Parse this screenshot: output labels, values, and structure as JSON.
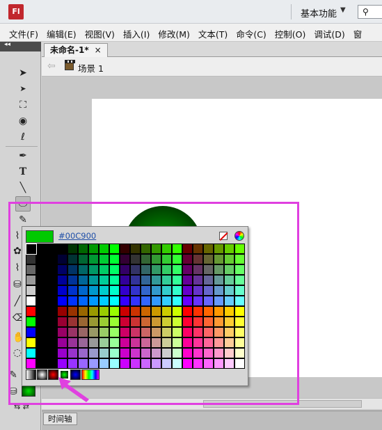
{
  "app": {
    "logo": "Fl",
    "workspace": "基本功能",
    "workspace_arrow": "▼",
    "search_placeholder": ""
  },
  "menu": [
    "文件(F)",
    "编辑(E)",
    "视图(V)",
    "插入(I)",
    "修改(M)",
    "文本(T)",
    "命令(C)",
    "控制(O)",
    "调试(D)",
    "窗"
  ],
  "tools": {
    "collapse": "◂◂",
    "icons": [
      "selection-tool-icon",
      "subselection-tool-icon",
      "free-transform-tool-icon",
      "3d-rotation-tool-icon",
      "lasso-tool-icon",
      "pen-tool-icon",
      "text-tool-icon",
      "line-tool-icon",
      "oval-tool-icon",
      "pencil-tool-icon",
      "brush-tool-icon",
      "deco-tool-icon",
      "bone-tool-icon",
      "paint-bucket-tool-icon",
      "eyedropper-tool-icon",
      "eraser-tool-icon",
      "hand-tool-icon",
      "zoom-tool-icon",
      "stroke-color-icon",
      "fill-color-icon",
      "swap-colors-icon"
    ]
  },
  "document": {
    "tab_label": "未命名-1*",
    "tab_close": "×",
    "scene_label": "场景 1",
    "back_arrow": "⇦",
    "timeline_label": "时间轴"
  },
  "color_picker": {
    "hex": "#00C900",
    "preview_color": "#00c900",
    "gradient_swatches": [
      "#999999-gradient",
      "white-black-radial",
      "red-radial",
      "green-radial",
      "blue-radial",
      "rainbow-linear"
    ]
  },
  "colors": {
    "highlight": "#e040e0",
    "fill": "#00c900"
  }
}
